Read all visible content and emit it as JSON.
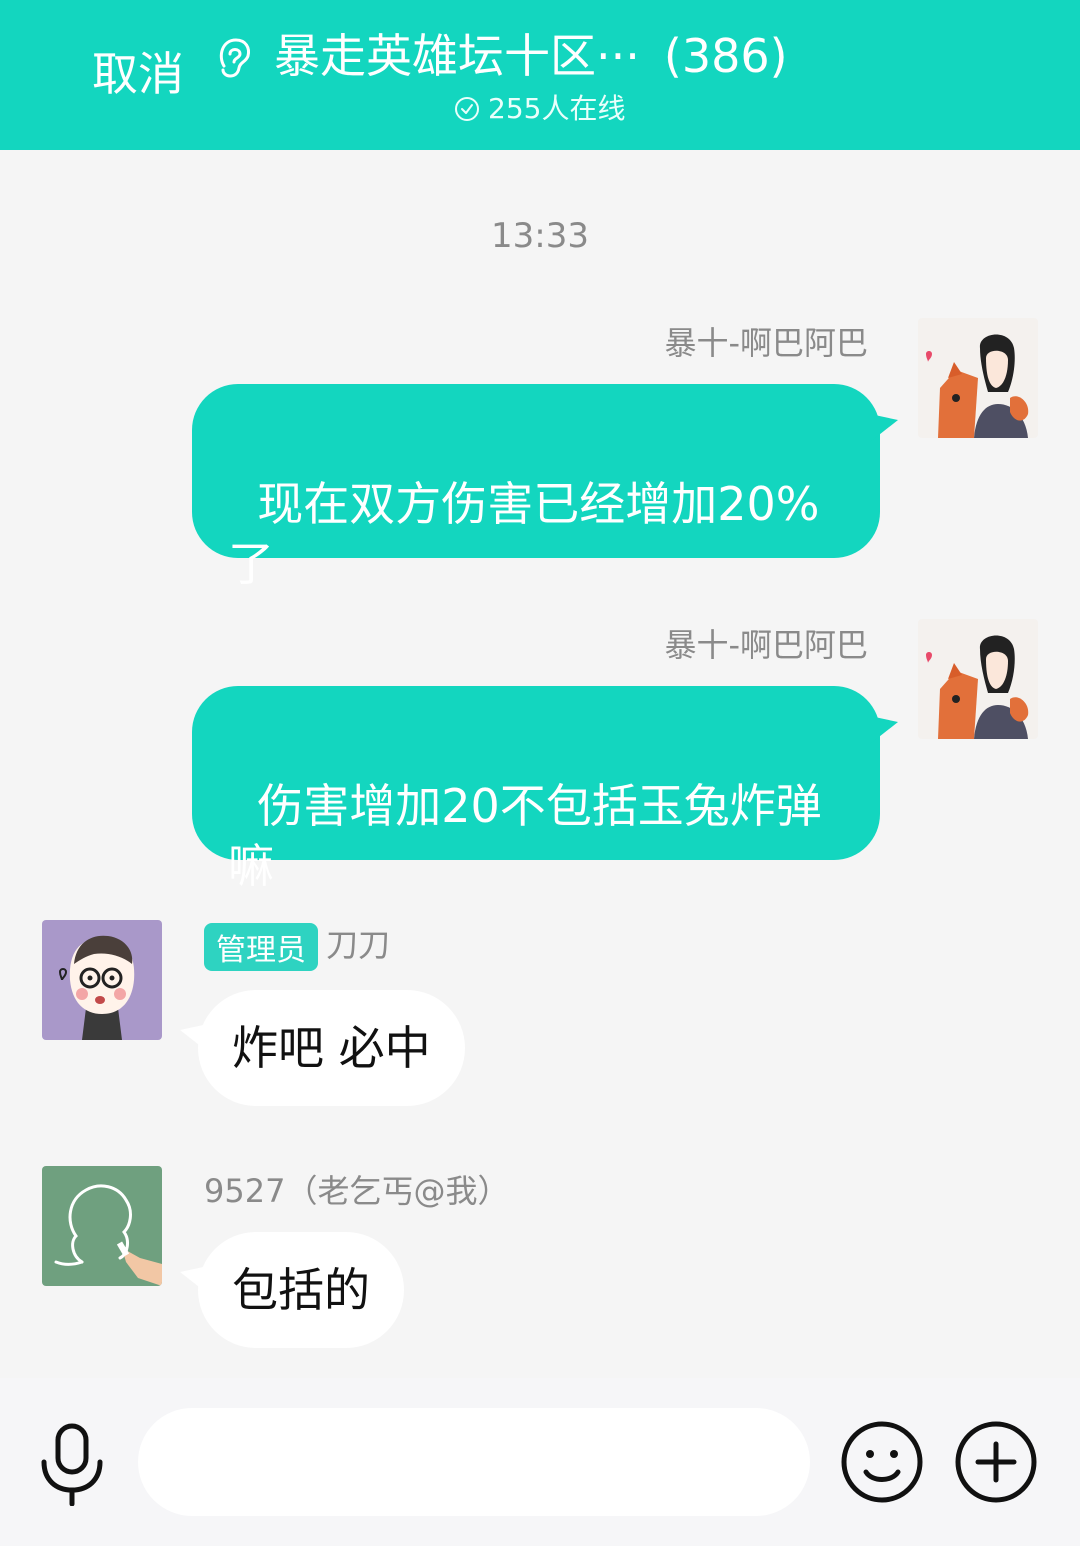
{
  "header": {
    "cancel_label": "取消",
    "title": "暴走英雄坛十区···",
    "member_count": "(386)",
    "online_text": "255人在线"
  },
  "chat": {
    "timestamp": "13:33",
    "messages": [
      {
        "sender": "暴十-啊巴阿巴",
        "text": "现在双方伤害已经增加20%\n了",
        "side": "right"
      },
      {
        "sender": "暴十-啊巴阿巴",
        "text": "伤害增加20不包括玉兔炸弹\n嘛",
        "side": "right"
      },
      {
        "badge": "管理员",
        "sender": "刀刀",
        "text": "炸吧 必中",
        "side": "left"
      },
      {
        "sender": "9527（老乞丐@我）",
        "text": "包括的",
        "side": "left"
      }
    ]
  },
  "colors": {
    "accent": "#13d6bf",
    "bubble_left": "#ffffff",
    "background": "#f5f5f5"
  },
  "icons": {
    "ear": "ear-icon",
    "online_check": "check-circle-icon",
    "mic": "microphone-icon",
    "emoji": "smiley-icon",
    "plus": "plus-circle-icon"
  }
}
